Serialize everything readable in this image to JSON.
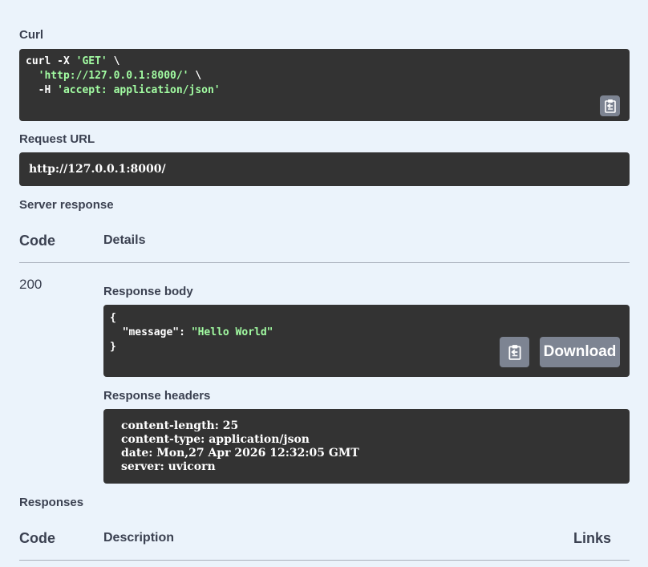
{
  "curl": {
    "label": "Curl",
    "lines": [
      {
        "pre": "curl -X ",
        "str": "'GET'",
        "post": " \\"
      },
      {
        "pre": "  ",
        "str": "'http://127.0.0.1:8000/'",
        "post": " \\"
      },
      {
        "pre": "  -H ",
        "str": "'accept: application/json'",
        "post": ""
      }
    ],
    "copy_icon": "clipboard-icon"
  },
  "request_url": {
    "label": "Request URL",
    "value": "http://127.0.0.1:8000/"
  },
  "server_response": {
    "label": "Server response",
    "code_header": "Code",
    "details_header": "Details",
    "code": "200",
    "body_label": "Response body",
    "body_lines": [
      {
        "pre": "{",
        "key": "",
        "sep": "",
        "str": ""
      },
      {
        "pre": "  ",
        "key": "\"message\"",
        "sep": ": ",
        "str": "\"Hello World\""
      },
      {
        "pre": "}",
        "key": "",
        "sep": "",
        "str": ""
      }
    ],
    "download_label": "Download",
    "headers_label": "Response headers",
    "headers": [
      "content-length: 25",
      "content-type: application/json",
      "date: Mon,27 Apr 2026 12:32:05 GMT",
      "server: uvicorn"
    ]
  },
  "responses": {
    "label": "Responses",
    "code_header": "Code",
    "description_header": "Description",
    "links_header": "Links"
  },
  "colors": {
    "background": "#ebf3fb",
    "code_bg": "#333333",
    "string_green": "#a2fca2",
    "button_gray": "#7d8492"
  }
}
